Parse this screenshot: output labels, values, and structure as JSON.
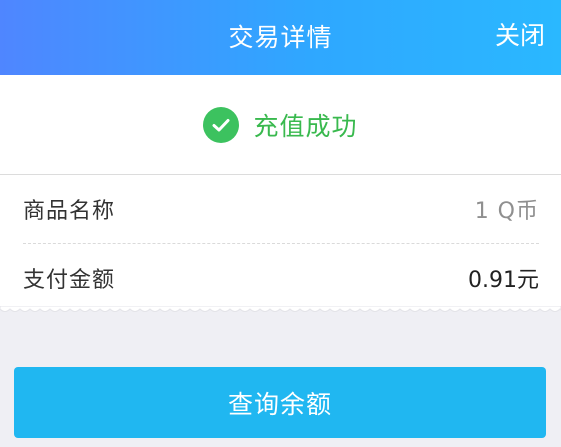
{
  "header": {
    "title": "交易详情",
    "close_label": "关闭"
  },
  "status": {
    "icon": "check-circle-icon",
    "text": "充值成功",
    "color": "#3cc25f"
  },
  "details": [
    {
      "label": "商品名称",
      "value": "1 Q币"
    },
    {
      "label": "支付金额",
      "value": "0.91元"
    }
  ],
  "action": {
    "label": "查询余额"
  },
  "colors": {
    "header_start": "#4f86ff",
    "header_end": "#2ab8ff",
    "button": "#20b7f1",
    "background": "#efeff4"
  }
}
